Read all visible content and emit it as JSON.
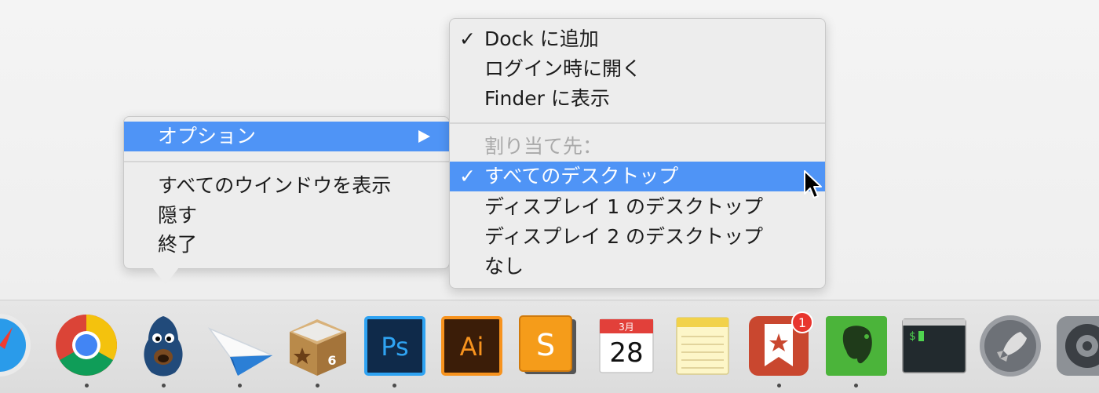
{
  "context_menu": {
    "options_label": "オプション",
    "items": [
      "すべてのウインドウを表示",
      "隠す",
      "終了"
    ]
  },
  "submenu": {
    "check_mark": "✓",
    "add_to_dock": "Dock に追加",
    "open_at_login": "ログイン時に開く",
    "show_in_finder": "Finder に表示",
    "assign_to_header": "割り当て先：",
    "all_desktops": "すべてのデスクトップ",
    "display1_desktop": "ディスプレイ 1 のデスクトップ",
    "display2_desktop": "ディスプレイ 2 のデスクトップ",
    "none": "なし"
  },
  "dock": {
    "calendar_month": "3月",
    "calendar_day": "28",
    "photoshop_label": "Ps",
    "illustrator_label": "Ai",
    "sketch_label": "S",
    "mailbox_label": "6",
    "wunderlist_badge": "1",
    "terminal_prompt": "$"
  },
  "colors": {
    "highlight": "#4f94f6",
    "badge": "#e8352e",
    "evernote": "#4bb43a",
    "photoshop": "#0f2a4a",
    "illustrator": "#3b1d08",
    "sketch": "#f59c1a"
  }
}
